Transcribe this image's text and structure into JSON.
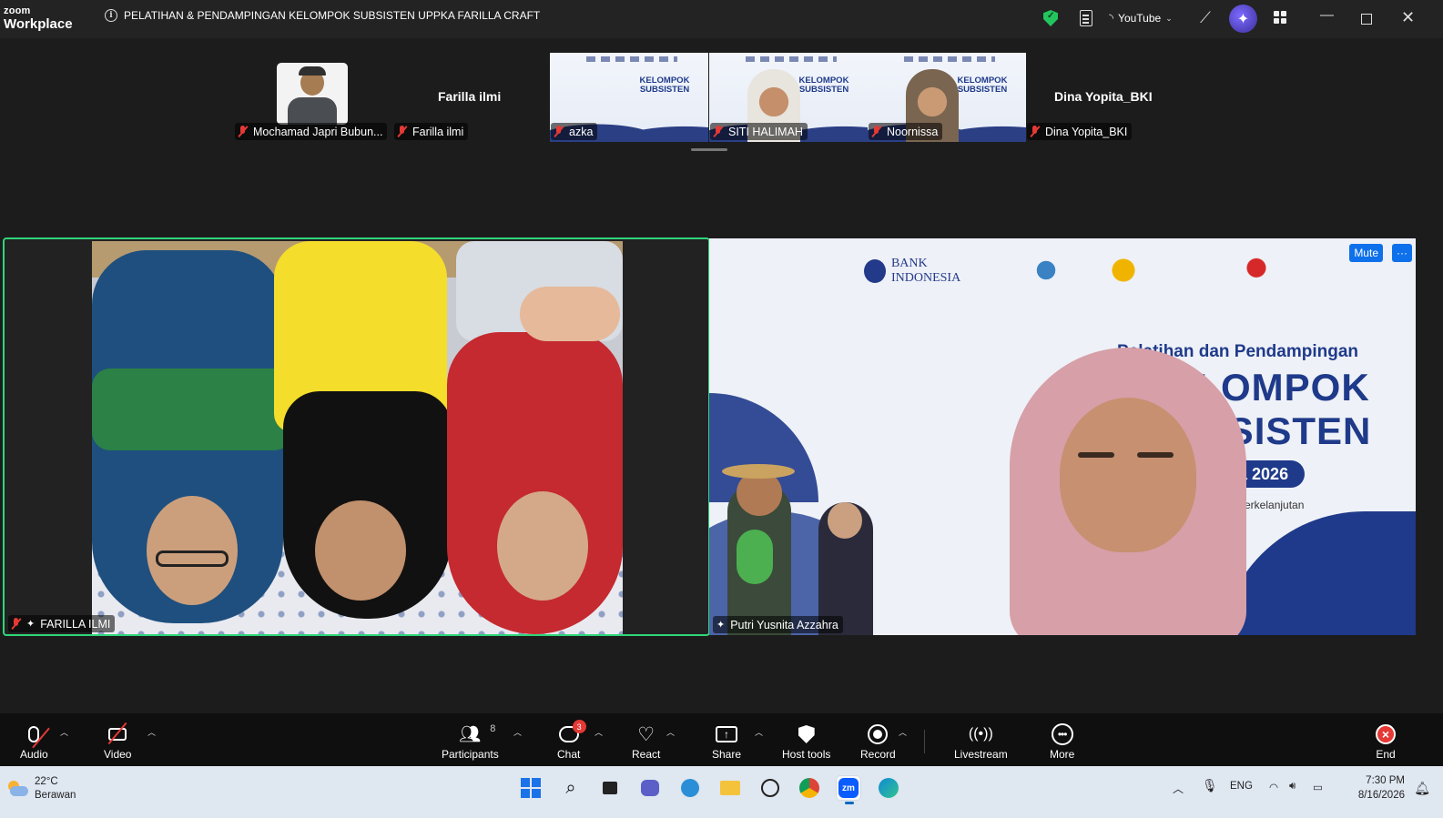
{
  "app": {
    "logo_line1": "zoom",
    "logo_line2": "Workplace",
    "meeting_title": "PELATIHAN & PENDAMPINGAN KELOMPOK SUBSISTEN UPPKA FARILLA CRAFT",
    "youtube_label": "YouTube",
    "accent_color": "#0e71eb",
    "active_speaker_color": "#2fd67a",
    "muted_color": "#e53935"
  },
  "strip": {
    "participants": [
      {
        "name": "Mochamad Japri Bubun...",
        "muted": true
      },
      {
        "name": "Farilla ilmi",
        "muted": true,
        "display_name": "Farilla ilmi"
      },
      {
        "name": "azka",
        "muted": true
      },
      {
        "name": "SITI HALIMAH",
        "muted": true
      },
      {
        "name": "Noornissa",
        "muted": true
      },
      {
        "name": "Dina Yopita_BKI",
        "muted": true,
        "display_name": "Dina Yopita_BKI"
      }
    ],
    "slide_text": "Pelatihan dan Pendampingan",
    "slide_title_1": "KELOMPOK",
    "slide_title_2": "SUBSISTEN"
  },
  "main": {
    "left_tile_name": "FARILLA ILMI",
    "right_tile_name": "Putri Yusnita Azzahra",
    "mute_label": "Mute",
    "more_label": "···",
    "slide_heading": "Pelatihan dan Pendampingan",
    "slide_big_1": "KELOMPOK",
    "slide_big_2": "SUBSISTEN",
    "slide_year": "Bank Indonesia 2026",
    "slide_sub": "Berkelanjutan",
    "bank_logo": "BANK INDONESIA"
  },
  "toolbar": {
    "audio": "Audio",
    "video": "Video",
    "participants": "Participants",
    "participants_count": "8",
    "chat": "Chat",
    "chat_badge": "3",
    "react": "React",
    "share": "Share",
    "host_tools": "Host tools",
    "record": "Record",
    "livestream": "Livestream",
    "more": "More",
    "end": "End"
  },
  "taskbar": {
    "temperature": "22°C",
    "weather": "Berawan",
    "language": "ENG",
    "time": "7:30 PM",
    "date": "8/16/2026"
  }
}
